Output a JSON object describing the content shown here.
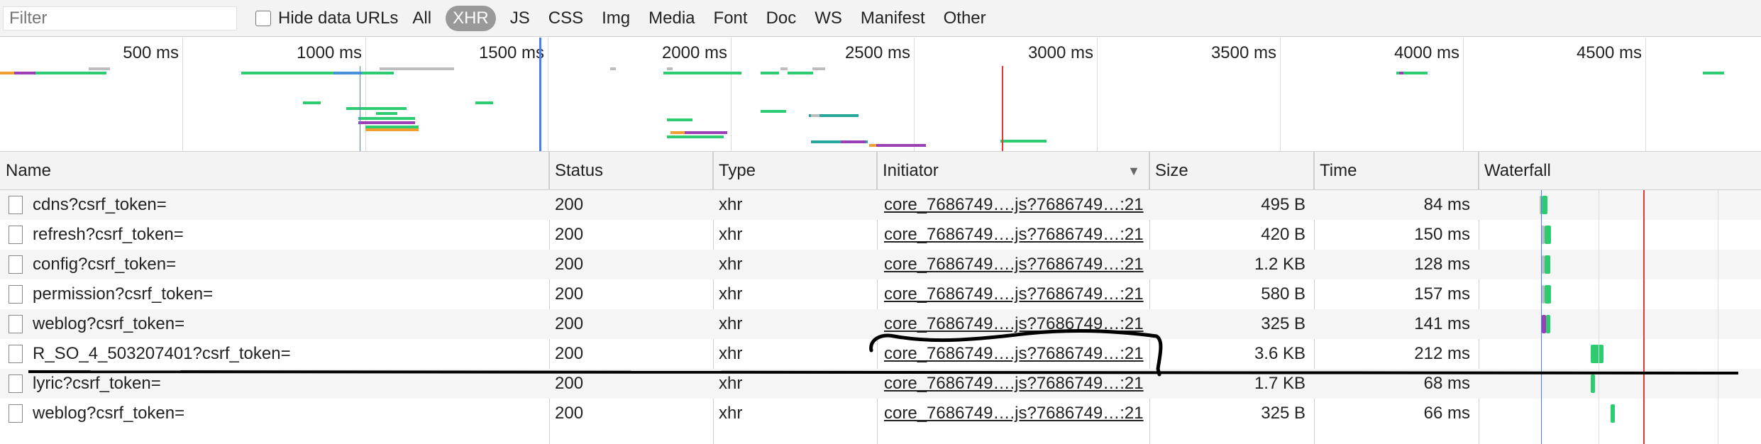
{
  "filterbar": {
    "filter_placeholder": "Filter",
    "hide_data_urls_label": "Hide data URLs",
    "types": [
      "All",
      "XHR",
      "JS",
      "CSS",
      "Img",
      "Media",
      "Font",
      "Doc",
      "WS",
      "Manifest",
      "Other"
    ],
    "active_type": "XHR"
  },
  "overview": {
    "ticks": [
      "500 ms",
      "1000 ms",
      "1500 ms",
      "2000 ms",
      "2500 ms",
      "3000 ms",
      "3500 ms",
      "4000 ms",
      "4500 ms"
    ]
  },
  "columns": {
    "name": "Name",
    "status": "Status",
    "type": "Type",
    "initiator": "Initiator",
    "size": "Size",
    "time": "Time",
    "waterfall": "Waterfall"
  },
  "rows": [
    {
      "name": "cdns?csrf_token=",
      "status": "200",
      "type": "xhr",
      "initiator": "core_7686749….js?7686749…:21",
      "size": "495 B",
      "time": "84 ms"
    },
    {
      "name": "refresh?csrf_token=",
      "status": "200",
      "type": "xhr",
      "initiator": "core_7686749….js?7686749…:21",
      "size": "420 B",
      "time": "150 ms"
    },
    {
      "name": "config?csrf_token=",
      "status": "200",
      "type": "xhr",
      "initiator": "core_7686749….js?7686749…:21",
      "size": "1.2 KB",
      "time": "128 ms"
    },
    {
      "name": "permission?csrf_token=",
      "status": "200",
      "type": "xhr",
      "initiator": "core_7686749….js?7686749…:21",
      "size": "580 B",
      "time": "157 ms"
    },
    {
      "name": "weblog?csrf_token=",
      "status": "200",
      "type": "xhr",
      "initiator": "core_7686749….js?7686749…:21",
      "size": "325 B",
      "time": "141 ms"
    },
    {
      "name": "R_SO_4_503207401?csrf_token=",
      "status": "200",
      "type": "xhr",
      "initiator": "core_7686749….js?7686749…:21",
      "size": "3.6 KB",
      "time": "212 ms"
    },
    {
      "name": "lyric?csrf_token=",
      "status": "200",
      "type": "xhr",
      "initiator": "core_7686749….js?7686749…:21",
      "size": "1.7 KB",
      "time": "68 ms"
    },
    {
      "name": "weblog?csrf_token=",
      "status": "200",
      "type": "xhr",
      "initiator": "core_7686749….js?7686749…:21",
      "size": "325 B",
      "time": "66 ms"
    }
  ],
  "colors": {
    "green": "#2ecc71",
    "teal": "#26a69a",
    "purple": "#9b3fb5",
    "orange": "#f0a030",
    "blue_marker": "#4a7df0",
    "red_marker": "#e53935",
    "gray": "#bdbdbd"
  }
}
